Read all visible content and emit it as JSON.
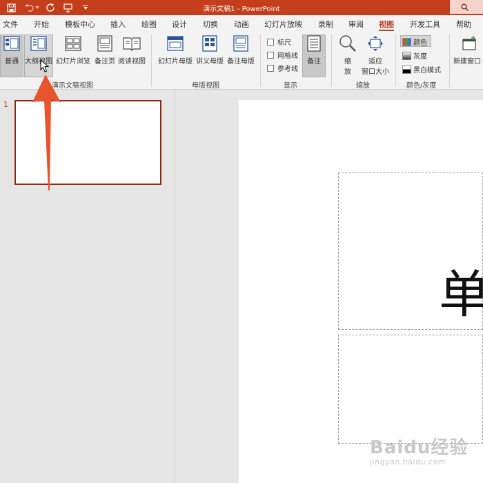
{
  "window": {
    "title": "演示文稿1 - PowerPoint"
  },
  "tabs": [
    {
      "label": "文件"
    },
    {
      "label": "开始"
    },
    {
      "label": "模板中心"
    },
    {
      "label": "插入"
    },
    {
      "label": "绘图"
    },
    {
      "label": "设计"
    },
    {
      "label": "切换"
    },
    {
      "label": "动画"
    },
    {
      "label": "幻灯片放映"
    },
    {
      "label": "录制"
    },
    {
      "label": "审阅"
    },
    {
      "label": "视图",
      "active": true
    },
    {
      "label": "开发工具"
    },
    {
      "label": "帮助"
    }
  ],
  "ribbon": {
    "presentation_views": {
      "label": "演示文稿视图",
      "buttons": [
        {
          "label": "普通",
          "icon": "normal-view-icon",
          "selected": true
        },
        {
          "label": "大纲视图",
          "icon": "outline-view-icon",
          "hovered": true
        },
        {
          "label": "幻灯片浏览",
          "icon": "slide-sorter-icon"
        },
        {
          "label": "备注页",
          "icon": "notes-page-icon"
        },
        {
          "label": "阅读视图",
          "icon": "reading-view-icon"
        }
      ]
    },
    "master_views": {
      "label": "母版视图",
      "buttons": [
        {
          "label": "幻灯片母版",
          "icon": "slide-master-icon"
        },
        {
          "label": "讲义母版",
          "icon": "handout-master-icon"
        },
        {
          "label": "备注母版",
          "icon": "notes-master-icon"
        }
      ]
    },
    "show": {
      "label": "显示",
      "checkboxes": [
        {
          "label": "标尺",
          "checked": false
        },
        {
          "label": "网格线",
          "checked": false
        },
        {
          "label": "参考线",
          "checked": false
        }
      ],
      "notes_button": {
        "label": "备注",
        "icon": "notes-icon",
        "selected": true
      }
    },
    "zoom": {
      "label": "缩放",
      "zoom_button": {
        "label_line1": "缩",
        "label_line2": "放",
        "icon": "zoom-magnifier-icon"
      },
      "fit_button": {
        "label_line1": "适应",
        "label_line2": "窗口大小",
        "icon": "fit-to-window-icon"
      }
    },
    "color_grayscale": {
      "label": "颜色/灰度",
      "items": [
        {
          "label": "颜色",
          "icon": "color-swatch-icon",
          "selected": true
        },
        {
          "label": "灰度",
          "icon": "grayscale-swatch-icon"
        },
        {
          "label": "黑白模式",
          "icon": "black-white-swatch-icon"
        }
      ]
    },
    "window_group": {
      "new_window": {
        "label": "新建窗口",
        "icon": "new-window-icon"
      }
    }
  },
  "slides_panel": {
    "slides": [
      {
        "number": "1"
      }
    ]
  },
  "canvas": {
    "visible_title_char": "单"
  },
  "watermark": {
    "brand": "Baidu经验",
    "url": "jingyan.baidu.com"
  },
  "colors": {
    "titlebar": "#c43e1c",
    "accent": "#b7472a",
    "annotation_arrow": "#e8542b"
  }
}
